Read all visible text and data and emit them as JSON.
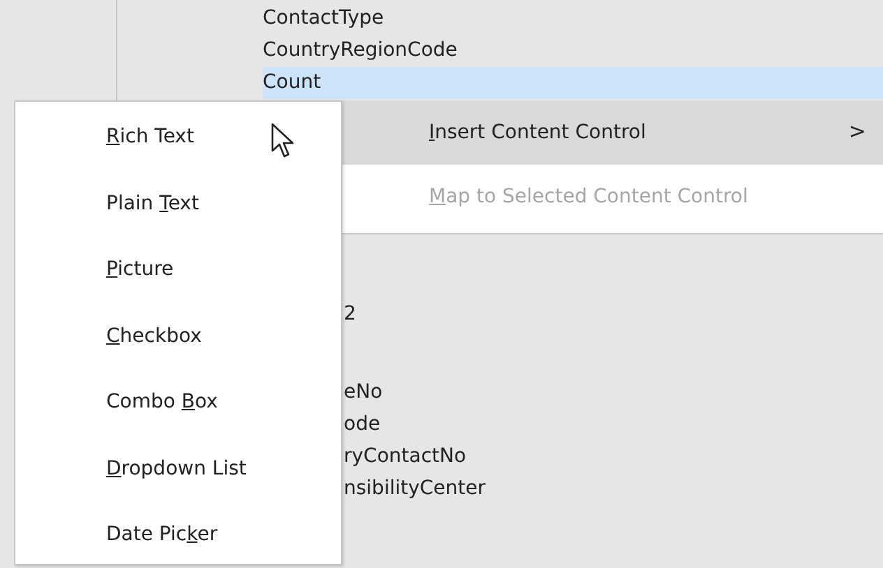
{
  "field_list": {
    "items": [
      {
        "label": "ContactType",
        "selected": false
      },
      {
        "label": "CountryRegionCode",
        "selected": false
      },
      {
        "label": "Count",
        "selected": true
      }
    ],
    "lower_items": [
      "2",
      "eNo",
      "ode",
      "ryContactNo",
      "nsibilityCenter"
    ]
  },
  "context_menu": {
    "items": [
      {
        "key": "I",
        "after": "nsert Content Control",
        "selected": true,
        "disabled": false,
        "arrow": ">"
      },
      {
        "key": "M",
        "after": "ap to Selected Content Control",
        "selected": false,
        "disabled": true
      }
    ]
  },
  "submenu": {
    "items": [
      {
        "key": "R",
        "after": "ich Text"
      },
      {
        "before": "Plain ",
        "key": "T",
        "after": "ext"
      },
      {
        "key": "P",
        "after": "icture"
      },
      {
        "key": "C",
        "after": "heckbox"
      },
      {
        "before": "Combo ",
        "key": "B",
        "after": "ox"
      },
      {
        "key": "D",
        "after": "ropdown List"
      },
      {
        "before": "Date Pic",
        "key": "k",
        "after": "er"
      }
    ]
  }
}
